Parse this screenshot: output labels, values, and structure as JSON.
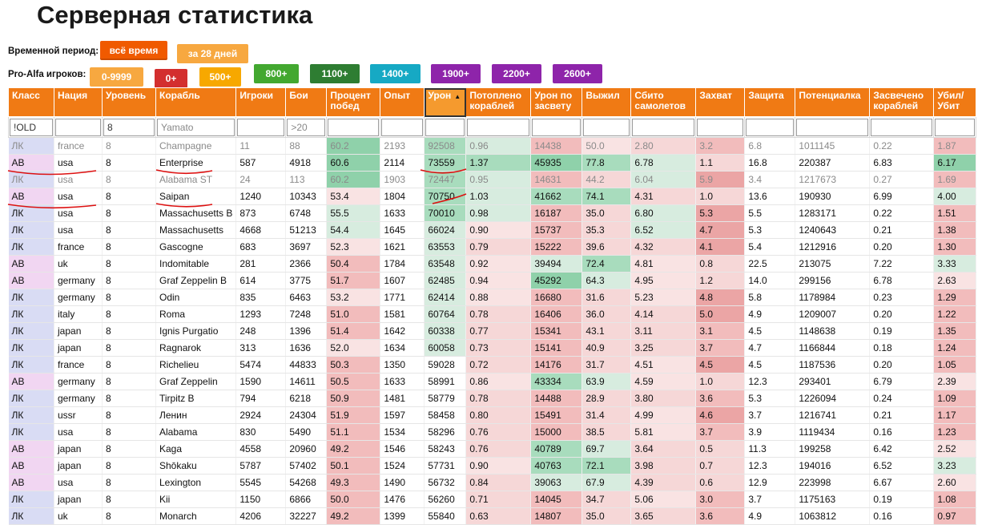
{
  "page": {
    "title": "Серверная статистика"
  },
  "time_filter": {
    "label": "Временной период:",
    "options": [
      {
        "label": "всё время",
        "color": "#f05a00",
        "active": true
      },
      {
        "label": "за 28 дней",
        "color": "#f7a840",
        "active": false
      }
    ]
  },
  "players_filter": {
    "label": "Pro-Alfa игроков:",
    "options": [
      {
        "label": "0-9999",
        "color": "#f7a840"
      },
      {
        "label": "0+",
        "color": "#d32f2f"
      },
      {
        "label": "500+",
        "color": "#f7a800"
      },
      {
        "label": "800+",
        "color": "#43a830"
      },
      {
        "label": "1100+",
        "color": "#2e7d32"
      },
      {
        "label": "1400+",
        "color": "#16a9c4"
      },
      {
        "label": "1900+",
        "color": "#8e24aa"
      },
      {
        "label": "2200+",
        "color": "#8e24aa"
      },
      {
        "label": "2600+",
        "color": "#8e24aa"
      }
    ]
  },
  "table": {
    "columns": [
      "Класс",
      "Нация",
      "Уровень",
      "Корабль",
      "Игроки",
      "Бои",
      "Процент побед",
      "Опыт",
      "Урон",
      "Потоплено кораблей",
      "Урон по засвету",
      "Выжил",
      "Сбито самолетов",
      "Захват",
      "Защита",
      "Потенциалка",
      "Засвечено кораблей",
      "Убил/ Убит"
    ],
    "sorted_column": "Урон",
    "filters": [
      {
        "value": "!OLD",
        "placeholder": ""
      },
      {
        "value": "",
        "placeholder": ""
      },
      {
        "value": "8",
        "placeholder": ""
      },
      {
        "value": "",
        "placeholder": "Yamato"
      },
      {
        "value": "",
        "placeholder": ""
      },
      {
        "value": "",
        "placeholder": ">20"
      },
      {
        "value": "",
        "placeholder": ""
      },
      {
        "value": "",
        "placeholder": ""
      },
      {
        "value": "",
        "placeholder": ""
      },
      {
        "value": "",
        "placeholder": ""
      },
      {
        "value": "",
        "placeholder": ""
      },
      {
        "value": "",
        "placeholder": ""
      },
      {
        "value": "",
        "placeholder": ""
      },
      {
        "value": "",
        "placeholder": ""
      },
      {
        "value": "",
        "placeholder": ""
      },
      {
        "value": "",
        "placeholder": ""
      },
      {
        "value": "",
        "placeholder": ""
      },
      {
        "value": "",
        "placeholder": ""
      }
    ],
    "rows": [
      {
        "dim": true,
        "cells": [
          "ЛК",
          "france",
          "8",
          "Champagne",
          "11",
          "88",
          "60.2",
          "2193",
          "92508",
          "0.96",
          "14438",
          "50.0",
          "2.80",
          "3.2",
          "6.8",
          "1011145",
          "0.22",
          "1.87"
        ]
      },
      {
        "dim": false,
        "cells": [
          "АВ",
          "usa",
          "8",
          "Enterprise",
          "587",
          "4918",
          "60.6",
          "2114",
          "73559",
          "1.37",
          "45935",
          "77.8",
          "6.78",
          "1.1",
          "16.8",
          "220387",
          "6.83",
          "6.17"
        ]
      },
      {
        "dim": true,
        "cells": [
          "ЛК",
          "usa",
          "8",
          "Alabama ST",
          "24",
          "113",
          "60.2",
          "1903",
          "72447",
          "0.95",
          "14631",
          "44.2",
          "6.04",
          "5.9",
          "3.4",
          "1217673",
          "0.27",
          "1.69"
        ]
      },
      {
        "dim": false,
        "cells": [
          "АВ",
          "usa",
          "8",
          "Saipan",
          "1240",
          "10343",
          "53.4",
          "1804",
          "70750",
          "1.03",
          "41662",
          "74.1",
          "4.31",
          "1.0",
          "13.6",
          "190930",
          "6.99",
          "4.00"
        ]
      },
      {
        "dim": false,
        "cells": [
          "ЛК",
          "usa",
          "8",
          "Massachusetts B",
          "873",
          "6748",
          "55.5",
          "1633",
          "70010",
          "0.98",
          "16187",
          "35.0",
          "6.80",
          "5.3",
          "5.5",
          "1283171",
          "0.22",
          "1.51"
        ]
      },
      {
        "dim": false,
        "cells": [
          "ЛК",
          "usa",
          "8",
          "Massachusetts",
          "4668",
          "51213",
          "54.4",
          "1645",
          "66024",
          "0.90",
          "15737",
          "35.3",
          "6.52",
          "4.7",
          "5.3",
          "1240643",
          "0.21",
          "1.38"
        ]
      },
      {
        "dim": false,
        "cells": [
          "ЛК",
          "france",
          "8",
          "Gascogne",
          "683",
          "3697",
          "52.3",
          "1621",
          "63553",
          "0.79",
          "15222",
          "39.6",
          "4.32",
          "4.1",
          "5.4",
          "1212916",
          "0.20",
          "1.30"
        ]
      },
      {
        "dim": false,
        "cells": [
          "АВ",
          "uk",
          "8",
          "Indomitable",
          "281",
          "2366",
          "50.4",
          "1784",
          "63548",
          "0.92",
          "39494",
          "72.4",
          "4.81",
          "0.8",
          "22.5",
          "213075",
          "7.22",
          "3.33"
        ]
      },
      {
        "dim": false,
        "cells": [
          "АВ",
          "germany",
          "8",
          "Graf Zeppelin B",
          "614",
          "3775",
          "51.7",
          "1607",
          "62485",
          "0.94",
          "45292",
          "64.3",
          "4.95",
          "1.2",
          "14.0",
          "299156",
          "6.78",
          "2.63"
        ]
      },
      {
        "dim": false,
        "cells": [
          "ЛК",
          "germany",
          "8",
          "Odin",
          "835",
          "6463",
          "53.2",
          "1771",
          "62414",
          "0.88",
          "16680",
          "31.6",
          "5.23",
          "4.8",
          "5.8",
          "1178984",
          "0.23",
          "1.29"
        ]
      },
      {
        "dim": false,
        "cells": [
          "ЛК",
          "italy",
          "8",
          "Roma",
          "1293",
          "7248",
          "51.0",
          "1581",
          "60764",
          "0.78",
          "16406",
          "36.0",
          "4.14",
          "5.0",
          "4.9",
          "1209007",
          "0.20",
          "1.22"
        ]
      },
      {
        "dim": false,
        "cells": [
          "ЛК",
          "japan",
          "8",
          "Ignis Purgatio",
          "248",
          "1396",
          "51.4",
          "1642",
          "60338",
          "0.77",
          "15341",
          "43.1",
          "3.11",
          "3.1",
          "4.5",
          "1148638",
          "0.19",
          "1.35"
        ]
      },
      {
        "dim": false,
        "cells": [
          "ЛК",
          "japan",
          "8",
          "Ragnarok",
          "313",
          "1636",
          "52.0",
          "1634",
          "60058",
          "0.73",
          "15141",
          "40.9",
          "3.25",
          "3.7",
          "4.7",
          "1166844",
          "0.18",
          "1.24"
        ]
      },
      {
        "dim": false,
        "cells": [
          "ЛК",
          "france",
          "8",
          "Richelieu",
          "5474",
          "44833",
          "50.3",
          "1350",
          "59028",
          "0.72",
          "14176",
          "31.7",
          "4.51",
          "4.5",
          "4.5",
          "1187536",
          "0.20",
          "1.05"
        ]
      },
      {
        "dim": false,
        "cells": [
          "АВ",
          "germany",
          "8",
          "Graf Zeppelin",
          "1590",
          "14611",
          "50.5",
          "1633",
          "58991",
          "0.86",
          "43334",
          "63.9",
          "4.59",
          "1.0",
          "12.3",
          "293401",
          "6.79",
          "2.39"
        ]
      },
      {
        "dim": false,
        "cells": [
          "ЛК",
          "germany",
          "8",
          "Tirpitz B",
          "794",
          "6218",
          "50.9",
          "1481",
          "58779",
          "0.78",
          "14488",
          "28.9",
          "3.80",
          "3.6",
          "5.3",
          "1226094",
          "0.24",
          "1.09"
        ]
      },
      {
        "dim": false,
        "cells": [
          "ЛК",
          "ussr",
          "8",
          "Ленин",
          "2924",
          "24304",
          "51.9",
          "1597",
          "58458",
          "0.80",
          "15491",
          "31.4",
          "4.99",
          "4.6",
          "3.7",
          "1216741",
          "0.21",
          "1.17"
        ]
      },
      {
        "dim": false,
        "cells": [
          "ЛК",
          "usa",
          "8",
          "Alabama",
          "830",
          "5490",
          "51.1",
          "1534",
          "58296",
          "0.76",
          "15000",
          "38.5",
          "5.81",
          "3.7",
          "3.9",
          "1119434",
          "0.16",
          "1.23"
        ]
      },
      {
        "dim": false,
        "cells": [
          "АВ",
          "japan",
          "8",
          "Kaga",
          "4558",
          "20960",
          "49.2",
          "1546",
          "58243",
          "0.76",
          "40789",
          "69.7",
          "3.64",
          "0.5",
          "11.3",
          "199258",
          "6.42",
          "2.52"
        ]
      },
      {
        "dim": false,
        "cells": [
          "АВ",
          "japan",
          "8",
          "Shōkaku",
          "5787",
          "57402",
          "50.1",
          "1524",
          "57731",
          "0.90",
          "40763",
          "72.1",
          "3.98",
          "0.7",
          "12.3",
          "194016",
          "6.52",
          "3.23"
        ]
      },
      {
        "dim": false,
        "cells": [
          "АВ",
          "usa",
          "8",
          "Lexington",
          "5545",
          "54268",
          "49.3",
          "1490",
          "56732",
          "0.84",
          "39063",
          "67.9",
          "4.39",
          "0.6",
          "12.9",
          "223998",
          "6.67",
          "2.60"
        ]
      },
      {
        "dim": false,
        "cells": [
          "ЛК",
          "japan",
          "8",
          "Kii",
          "1150",
          "6866",
          "50.0",
          "1476",
          "56260",
          "0.71",
          "14045",
          "34.7",
          "5.06",
          "3.0",
          "3.7",
          "1175163",
          "0.19",
          "1.08"
        ]
      },
      {
        "dim": false,
        "cells": [
          "ЛК",
          "uk",
          "8",
          "Monarch",
          "4206",
          "32227",
          "49.2",
          "1399",
          "55840",
          "0.63",
          "14807",
          "35.0",
          "3.65",
          "3.6",
          "4.9",
          "1063812",
          "0.16",
          "0.97"
        ]
      }
    ]
  }
}
